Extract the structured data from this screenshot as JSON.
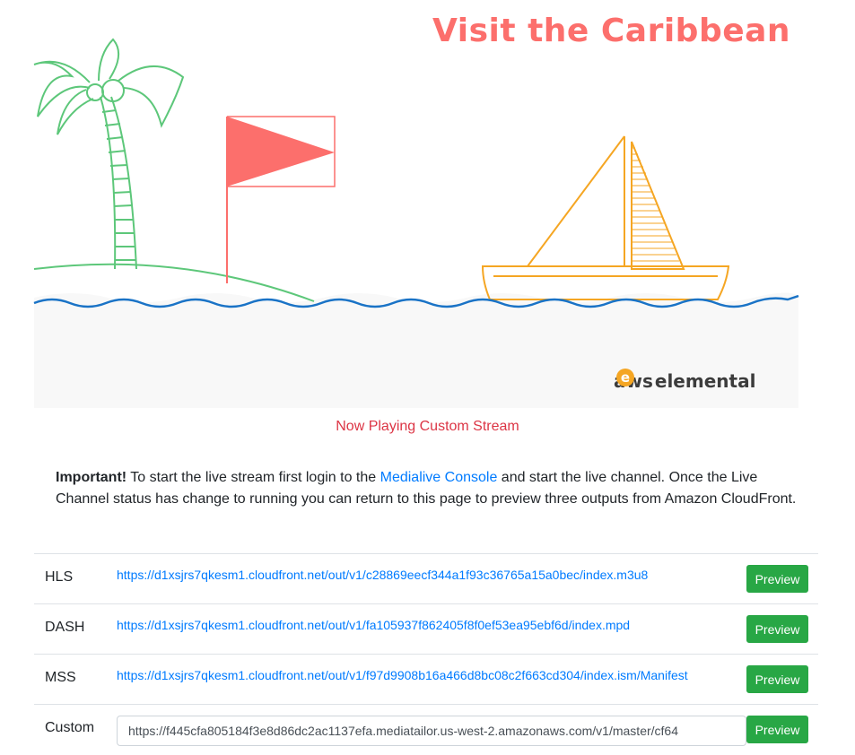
{
  "hero": {
    "title": "Visit the Caribbean",
    "brand_left": "aws",
    "brand_right": "elemental",
    "colors": {
      "title": "#fc6f6c",
      "palm": "#5dc77a",
      "flag": "#fc6f6c",
      "boat": "#f5a623",
      "wave": "#1a73c6",
      "brand_e": "#f5a623"
    }
  },
  "status": {
    "now_playing": "Now Playing Custom Stream"
  },
  "notice": {
    "strong": "Important!",
    "text_before": " To start the live stream first login to the ",
    "link": "Medialive Console",
    "text_after": " and start the live channel. Once the Live Channel status has change to running you can return to this page to preview three outputs from Amazon CloudFront."
  },
  "streams": [
    {
      "label": "HLS",
      "url": "https://d1xsjrs7qkesm1.cloudfront.net/out/v1/c28869eecf344a1f93c36765a15a0bec/index.m3u8",
      "button": "Preview"
    },
    {
      "label": "DASH",
      "url": "https://d1xsjrs7qkesm1.cloudfront.net/out/v1/fa105937f862405f8f0ef53ea95ebf6d/index.mpd",
      "button": "Preview"
    },
    {
      "label": "MSS",
      "url": "https://d1xsjrs7qkesm1.cloudfront.net/out/v1/f97d9908b16a466d8bc08c2f663cd304/index.ism/Manifest",
      "button": "Preview"
    }
  ],
  "custom": {
    "label": "Custom",
    "value": "https://f445cfa805184f3e8d86dc2ac1137efa.mediatailor.us-west-2.amazonaws.com/v1/master/cf64",
    "button": "Preview"
  }
}
